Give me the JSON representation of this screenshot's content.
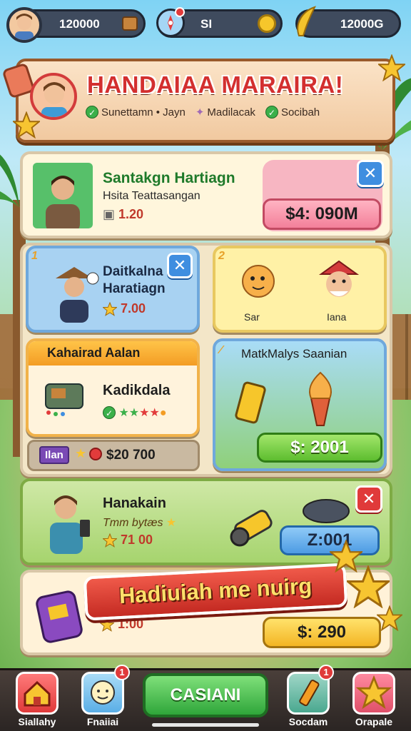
{
  "topbar": {
    "coins_left": "120000",
    "middle_value": "SI",
    "coins_right": "12000G"
  },
  "header": {
    "title": "HANDAIAA MARAIRA!",
    "tags": [
      "Sunettamn • Jayn",
      "Madilacak",
      "Socibah"
    ]
  },
  "featured": {
    "name": "Santakgn Hartiagn",
    "subtitle": "Hsita Teattasangan",
    "reward": "1.20",
    "price": "$4: 090M"
  },
  "card_blue": {
    "badge": "1",
    "name_line1": "Daitkalna",
    "name_line2": "Haratiagn",
    "reward": "7.00"
  },
  "card_yellow": {
    "badge": "2",
    "item1_label": "Sar",
    "item2_label": "Iana"
  },
  "card_orange": {
    "title": "Kahairad Aalan",
    "item_name": "Kadikdala"
  },
  "card_scenic": {
    "title": "MatkMalys Saanian",
    "price": "$: 2001"
  },
  "bottom_strip": {
    "tag": "Ilan",
    "price": "$20 700"
  },
  "card_green": {
    "name": "Hanakain",
    "subtitle": "Tmm bytæs",
    "reward": "71 00",
    "price": "Z:001"
  },
  "promo": {
    "banner": "Hadiuiah me nuirg",
    "reward": "1:00",
    "price": "$: 290"
  },
  "nav": {
    "center_label": "CASIANI",
    "items": [
      {
        "label": "Siallahy"
      },
      {
        "label": "Fnaiiai",
        "badge": "1"
      },
      {
        "label": "Socdam",
        "badge": "1"
      },
      {
        "label": "Orapale"
      }
    ]
  },
  "colors": {
    "accent_red": "#d32f2f",
    "accent_green": "#2fa63a",
    "accent_blue": "#3f8ee0",
    "gold": "#f6c62b"
  }
}
